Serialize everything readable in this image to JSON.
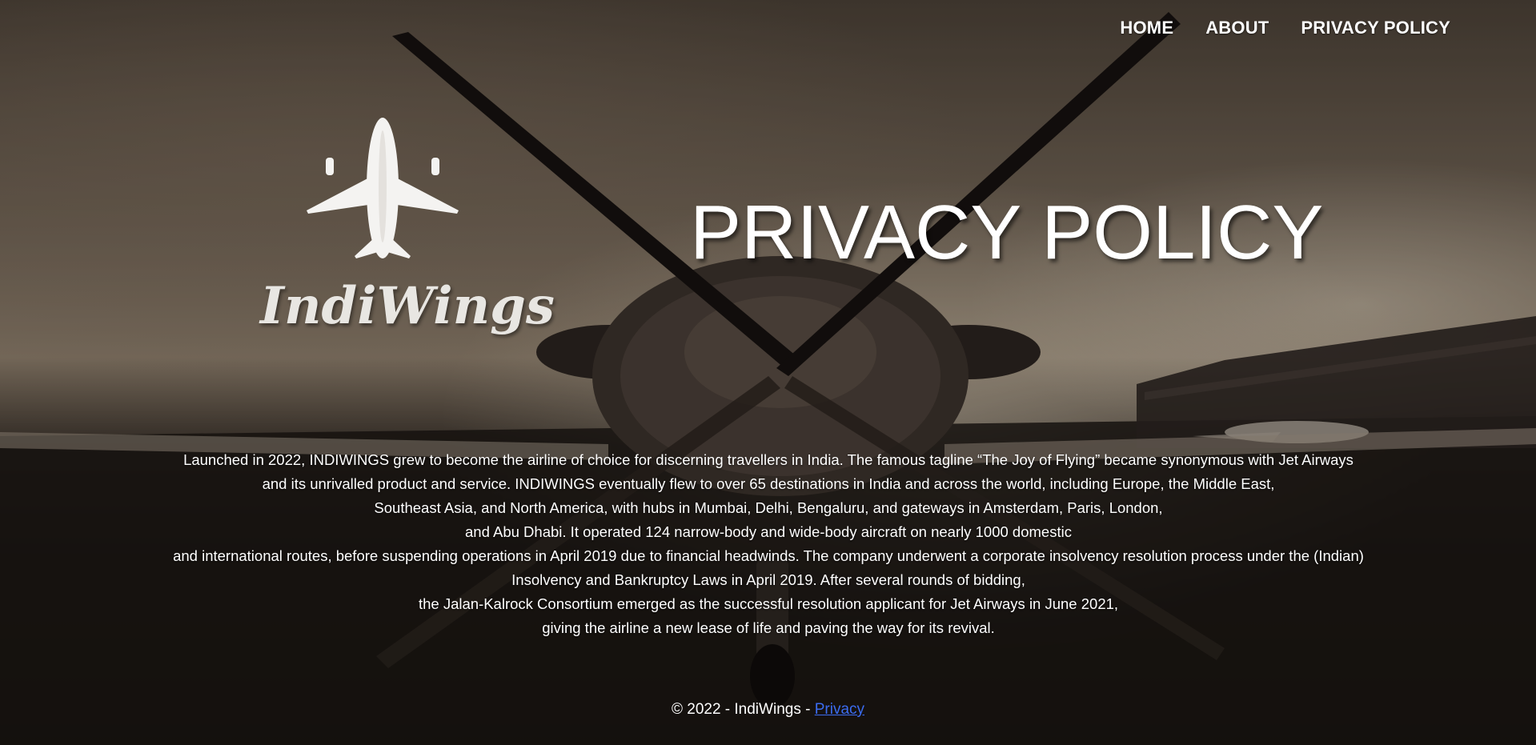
{
  "nav": {
    "items": [
      {
        "label": "HOME"
      },
      {
        "label": "ABOUT"
      },
      {
        "label": "PRIVACY POLICY"
      }
    ]
  },
  "logo": {
    "text": "IndiWings"
  },
  "page_title": "PRIVACY POLICY",
  "body": {
    "lines": [
      "Launched in 2022, INDIWINGS grew to become the airline of choice for discerning travellers in India. The famous tagline “The Joy of Flying” became synonymous with Jet Airways",
      "and its unrivalled product and service. INDIWINGS eventually flew to over 65 destinations in India and across the world, including Europe, the Middle East,",
      "Southeast Asia, and North America, with hubs in Mumbai, Delhi, Bengaluru, and gateways in Amsterdam, Paris, London,",
      "and Abu Dhabi. It operated 124 narrow-body and wide-body aircraft on nearly 1000 domestic",
      "and international routes, before suspending operations in April 2019 due to financial headwinds. The company underwent a corporate insolvency resolution process under the (Indian)",
      "Insolvency and Bankruptcy Laws in April 2019. After several rounds of bidding,",
      "the Jalan-Kalrock Consortium emerged as the successful resolution applicant for Jet Airways in June 2021,",
      "giving the airline a new lease of life and paving the way for its revival."
    ]
  },
  "footer": {
    "text": "© 2022 - IndiWings - ",
    "link_label": "Privacy"
  },
  "colors": {
    "link": "#3b6cf0",
    "text": "#ffffff"
  }
}
